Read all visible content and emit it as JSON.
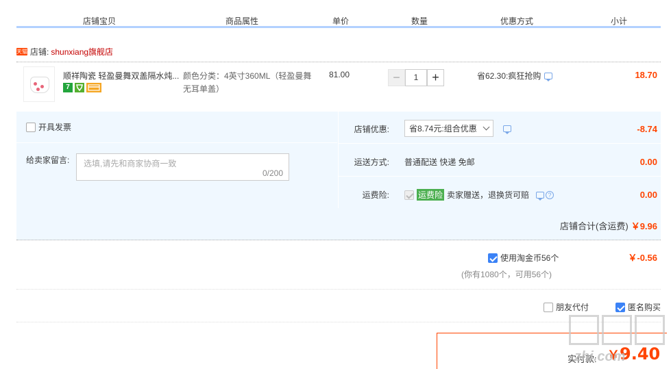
{
  "header": {
    "cols": [
      "店铺宝贝",
      "商品属性",
      "单价",
      "数量",
      "优惠方式",
      "小计"
    ]
  },
  "shop": {
    "icon_text": "天猫",
    "label": "店铺:",
    "name": "shunxiang旗舰店"
  },
  "item": {
    "title": "顺祥陶瓷 轻盈曼舞双盖隔水炖...",
    "badges": [
      "7",
      "",
      ""
    ],
    "props": "颜色分类：4英寸360ML（轻盈曼舞无耳单盖）",
    "price": "81.00",
    "qty": {
      "minus": "−",
      "value": "1",
      "plus": "+"
    },
    "promo": "省62.30:疯狂抢购",
    "subtotal": "18.70"
  },
  "lower": {
    "invoice_label": "开具发票",
    "msg_label": "给卖家留言:",
    "msg_placeholder": "选填,请先和商家协商一致",
    "msg_count": "0/200",
    "shop_promo_label": "店铺优惠:",
    "shop_promo_value": "省8.74元:组合优惠",
    "shop_promo_amount": "-8.74",
    "delivery_label": "运送方式:",
    "delivery_value": "普通配送 快递 免邮",
    "delivery_amount": "0.00",
    "insurance_label": "运费险:",
    "insurance_tag": "运费险",
    "insurance_text": "卖家赠送，退换货可赔",
    "insurance_q": "?",
    "insurance_amount": "0.00",
    "shop_total_label": "店铺合计(含运费)",
    "shop_total_amount": "￥9.96"
  },
  "coins": {
    "label": "使用淘金币56个",
    "amount": "￥-0.56",
    "note": "(你有1080个，可用56个)"
  },
  "options": {
    "friend_pay": "朋友代付",
    "anonymous": "匿名购买"
  },
  "pay": {
    "label": "实付款:",
    "yen": "￥",
    "amount": "9.40"
  },
  "watermark": {
    "text": "zhi.com"
  },
  "colors": {
    "accent": "#ff4400",
    "header_line": "#b2d1ff",
    "section_bg": "#f0f8ff",
    "checkbox_on": "#3b82f6"
  }
}
